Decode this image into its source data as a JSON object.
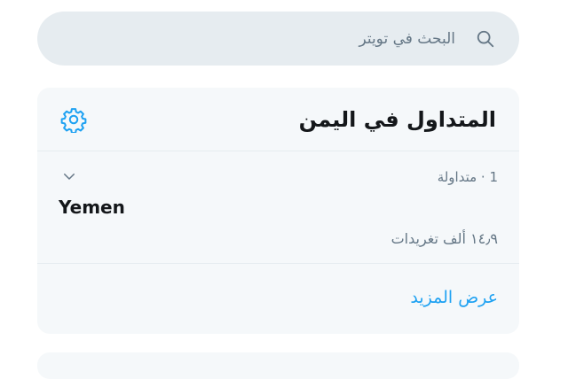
{
  "search": {
    "placeholder": "البحث في تويتر",
    "icon": "search-icon"
  },
  "trends_panel": {
    "title": "المتداول في اليمن",
    "settings_icon": "gear-icon",
    "items": [
      {
        "meta": "1 · متداولة",
        "name": "Yemen",
        "count": "١٤٫٩ ألف تغريدات",
        "menu_icon": "chevron-down-icon"
      }
    ],
    "show_more": "عرض المزيد"
  },
  "colors": {
    "accent": "#1da1f2",
    "panel_bg": "#f5f8fa",
    "search_bg": "#e6ecf0",
    "muted_text": "#657786",
    "primary_text": "#14171a"
  }
}
